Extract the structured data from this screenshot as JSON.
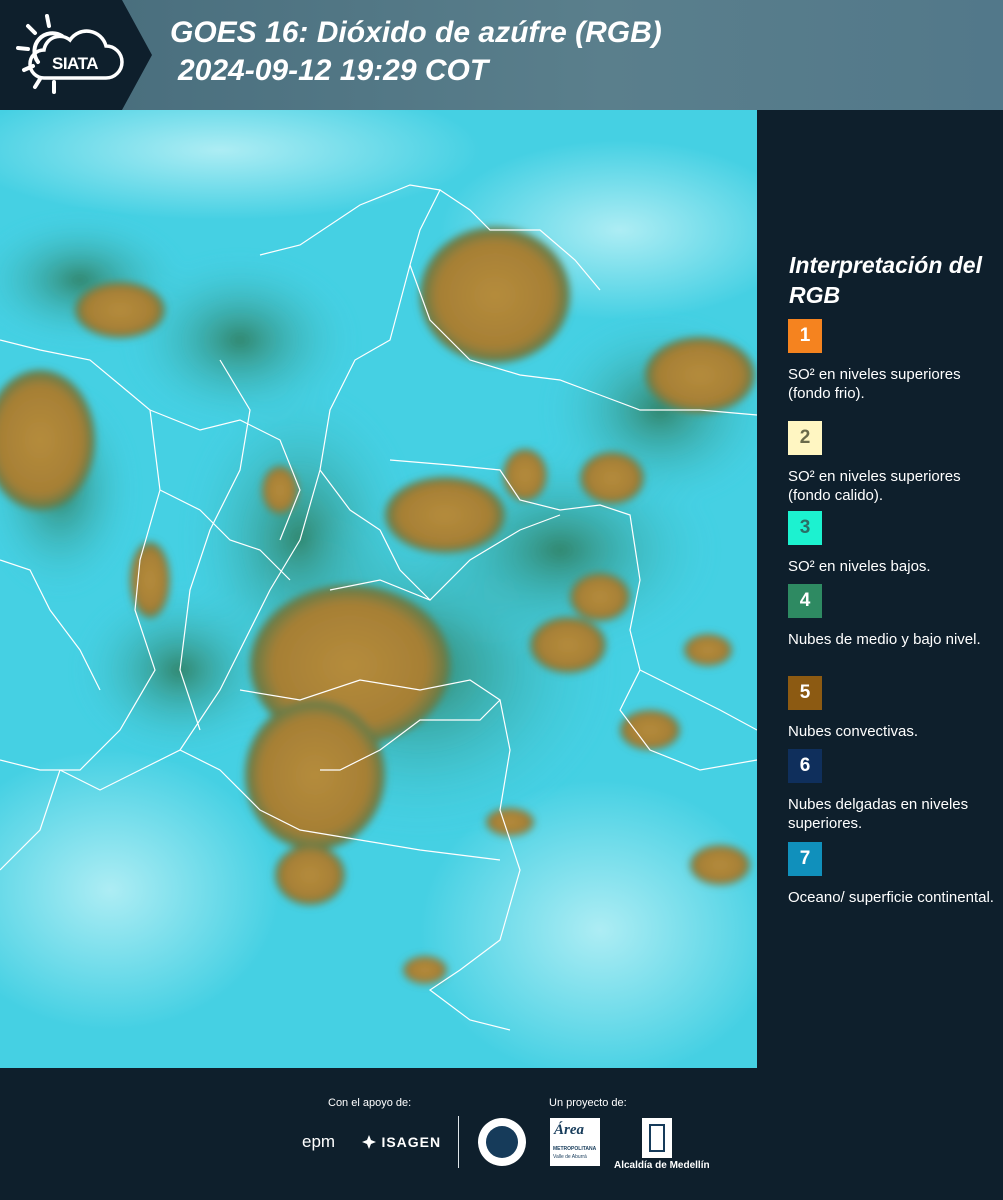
{
  "header": {
    "logo_text": "SIATA",
    "title_line1": "GOES 16: Dióxido de azúfre (RGB)",
    "title_line2": "2024-09-12 19:29 COT"
  },
  "legend": {
    "title": "Interpretación del RGB",
    "items": [
      {
        "number": "1",
        "color": "#f5831f",
        "number_color": "#ffffff",
        "text": "SO² en niveles superiores (fondo frio)."
      },
      {
        "number": "2",
        "color": "#fff6c2",
        "number_color": "#6a6a4a",
        "text": "SO² en niveles superiores (fondo calido)."
      },
      {
        "number": "3",
        "color": "#1cf2d0",
        "number_color": "#2a6f66",
        "text": "SO² en niveles bajos."
      },
      {
        "number": "4",
        "color": "#2e8a62",
        "number_color": "#ffffff",
        "text": "Nubes de medio y bajo nivel."
      },
      {
        "number": "5",
        "color": "#8c5a12",
        "number_color": "#ffffff",
        "text": "Nubes convectivas."
      },
      {
        "number": "6",
        "color": "#0f2f5c",
        "number_color": "#ffffff",
        "text": "Nubes delgadas en niveles superiores."
      },
      {
        "number": "7",
        "color": "#1090bc",
        "number_color": "#ffffff",
        "text": "Oceano/ superficie continental."
      }
    ]
  },
  "footer": {
    "support_label": "Con el apoyo de:",
    "project_label": "Un proyecto de:",
    "epm": "epm",
    "isagen": "ISAGEN",
    "area_name": "Área",
    "area_sub": "METROPOLITANA",
    "area_sub2": "Valle de Aburrá",
    "alcaldia": "Alcaldía de Medellín"
  },
  "colors": {
    "background": "#0e1f2c",
    "header_band": "#527888",
    "map_cyan": "#45d0e3",
    "convective": "#b08a3a",
    "mid_low_cloud": "#3f8a6a"
  },
  "icons": [
    "siata-sun-logo-icon",
    "isagen-logo-icon",
    "medellin-seal-icon",
    "area-metropolitana-logo-icon",
    "alcaldia-medellin-logo-icon"
  ]
}
